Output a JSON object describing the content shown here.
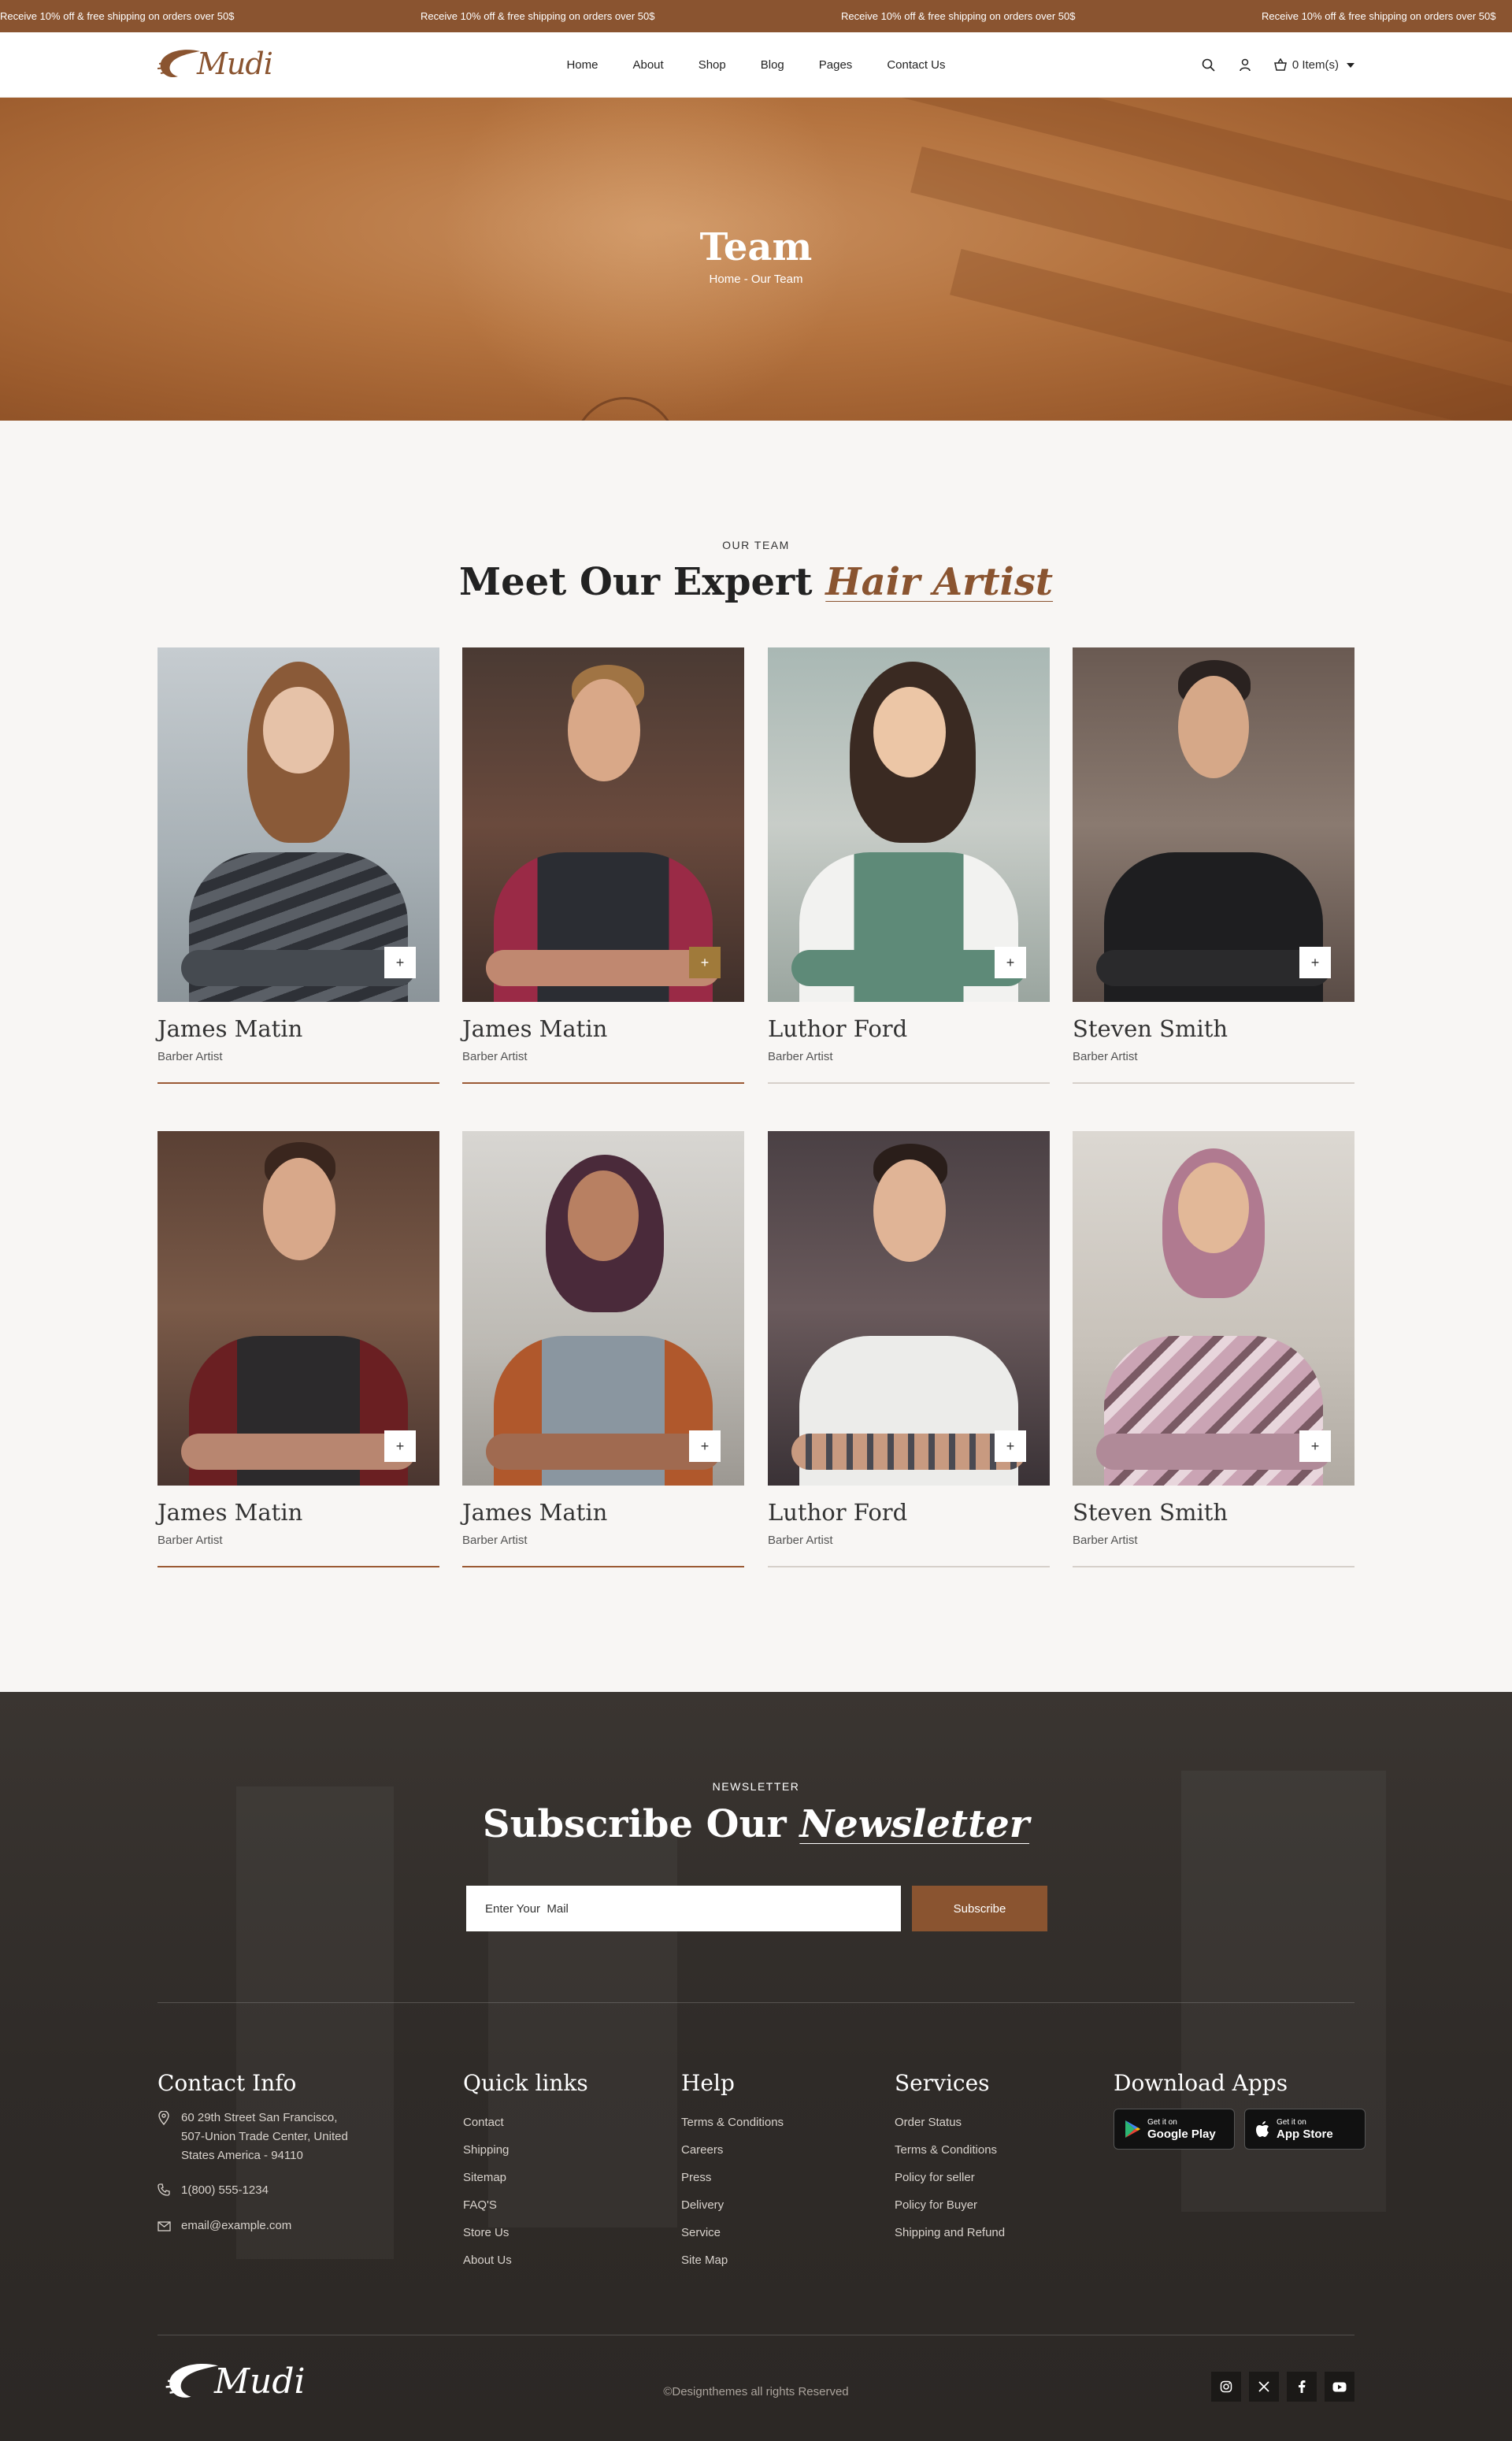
{
  "announcement": {
    "text": "Receive 10% off & free shipping on orders over 50$",
    "items": [
      "Receive 10% off & free shipping on orders over 50$",
      "Receive 10% off & free shipping on orders over 50$",
      "Receive 10% off & free shipping on orders over 50$",
      "Receive 10% off & free shipping on orders over 50$"
    ]
  },
  "header": {
    "logo_text": "Mudi",
    "nav": [
      "Home",
      "About",
      "Shop",
      "Blog",
      "Pages",
      "Contact Us"
    ],
    "cart_label": "0 Item(s)"
  },
  "hero": {
    "title": "Team",
    "breadcrumb": "Home - Our Team"
  },
  "team": {
    "eyebrow": "OUR TEAM",
    "title_main": "Meet Our Expert",
    "title_accent": "Hair Artist",
    "members": [
      {
        "name": "James Matin",
        "role": "Barber Artist",
        "plus": "+"
      },
      {
        "name": "James Matin",
        "role": "Barber Artist",
        "plus": "+"
      },
      {
        "name": "Luthor Ford",
        "role": "Barber Artist",
        "plus": "+"
      },
      {
        "name": "Steven Smith",
        "role": "Barber Artist",
        "plus": "+"
      },
      {
        "name": "James Matin",
        "role": "Barber Artist",
        "plus": "+"
      },
      {
        "name": "James Matin",
        "role": "Barber Artist",
        "plus": "+"
      },
      {
        "name": "Luthor Ford",
        "role": "Barber Artist",
        "plus": "+"
      },
      {
        "name": "Steven Smith",
        "role": "Barber Artist",
        "plus": "+"
      }
    ]
  },
  "newsletter": {
    "eyebrow": "NEWSLETTER",
    "title_main": "Subscribe Our",
    "title_accent": "Newsletter",
    "placeholder": "Enter Your  Mail",
    "button": "Subscribe"
  },
  "footer": {
    "contact": {
      "heading": "Contact Info",
      "address_lines": [
        "60 29th Street San Francisco,",
        "507-Union Trade Center, United",
        "States America - 94110"
      ],
      "phone": "1(800) 555-1234",
      "email": "email@example.com"
    },
    "quick_links": {
      "heading": "Quick links",
      "items": [
        "Contact",
        "Shipping",
        "Sitemap",
        "FAQ'S",
        "Store Us",
        "About Us"
      ]
    },
    "help": {
      "heading": "Help",
      "items": [
        "Terms & Conditions",
        "Careers",
        "Press",
        "Delivery",
        "Service",
        "Site Map"
      ]
    },
    "services": {
      "heading": "Services",
      "items": [
        "Order Status",
        "Terms & Conditions",
        "Policy for seller",
        "Policy for Buyer",
        "Shipping and Refund"
      ]
    },
    "apps": {
      "heading": "Download Apps",
      "google_small": "Get it on",
      "google_big": "Google Play",
      "apple_small": "Get it on",
      "apple_big": "App Store"
    },
    "logo_text": "Mudi",
    "copyright": "©Designthemes all rights Reserved",
    "social_icons": [
      "instagram-icon",
      "x-icon",
      "facebook-icon",
      "youtube-icon"
    ]
  },
  "colors": {
    "brand": "#8a5430",
    "accent_line": "#9b5a34",
    "footer_bg": "#2f2b28"
  }
}
